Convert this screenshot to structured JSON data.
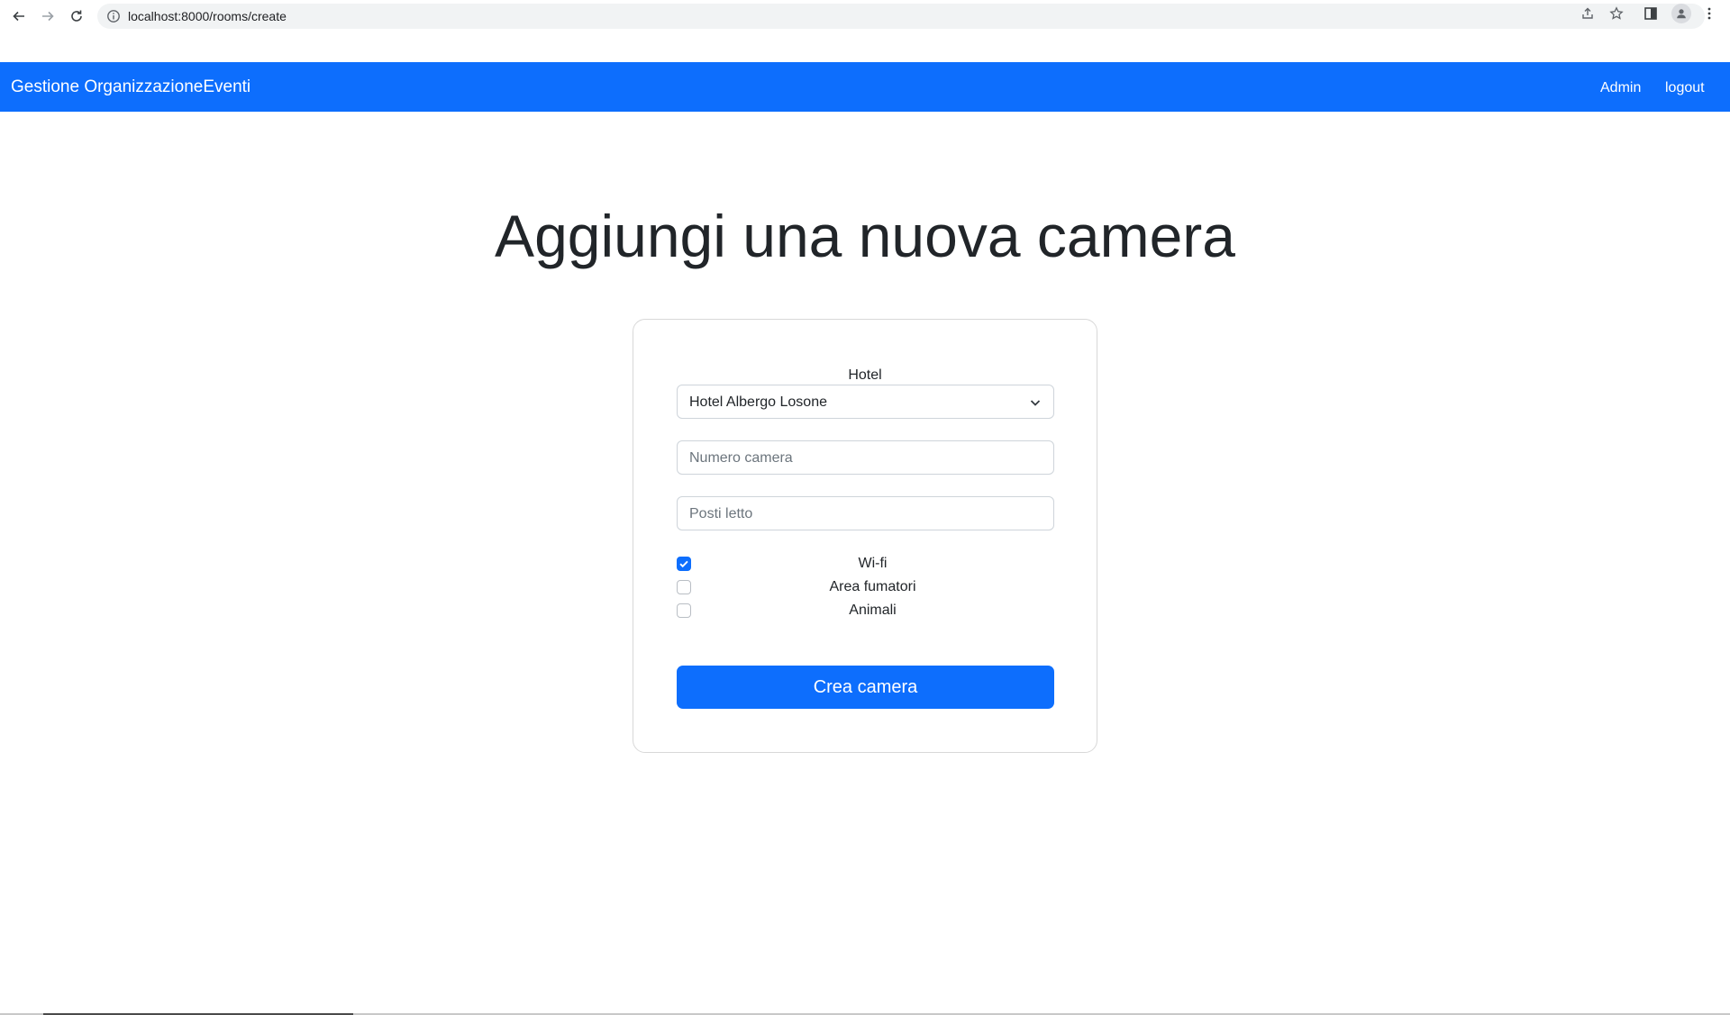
{
  "browser": {
    "url": "localhost:8000/rooms/create"
  },
  "navbar": {
    "brand": "Gestione OrganizzazioneEventi",
    "links": [
      "Admin",
      "logout"
    ],
    "color": "#0d6efd"
  },
  "main": {
    "title": "Aggiungi una nuova camera"
  },
  "form": {
    "hotel_label": "Hotel",
    "hotel_selected": "Hotel Albergo Losone",
    "room_number_placeholder": "Numero camera",
    "beds_placeholder": "Posti letto",
    "options": [
      {
        "label": "Wi-fi",
        "checked": true
      },
      {
        "label": "Area fumatori",
        "checked": false
      },
      {
        "label": "Animali",
        "checked": false
      }
    ],
    "submit_label": "Crea camera"
  },
  "icons": {
    "back": "back-arrow-icon",
    "forward": "forward-arrow-icon",
    "reload": "reload-icon",
    "info": "info-icon",
    "share": "share-icon",
    "star": "star-icon",
    "sidepanel": "side-panel-icon",
    "profile": "profile-icon",
    "menu": "kebab-menu-icon",
    "chevron": "chevron-down-icon",
    "check": "check-icon"
  }
}
